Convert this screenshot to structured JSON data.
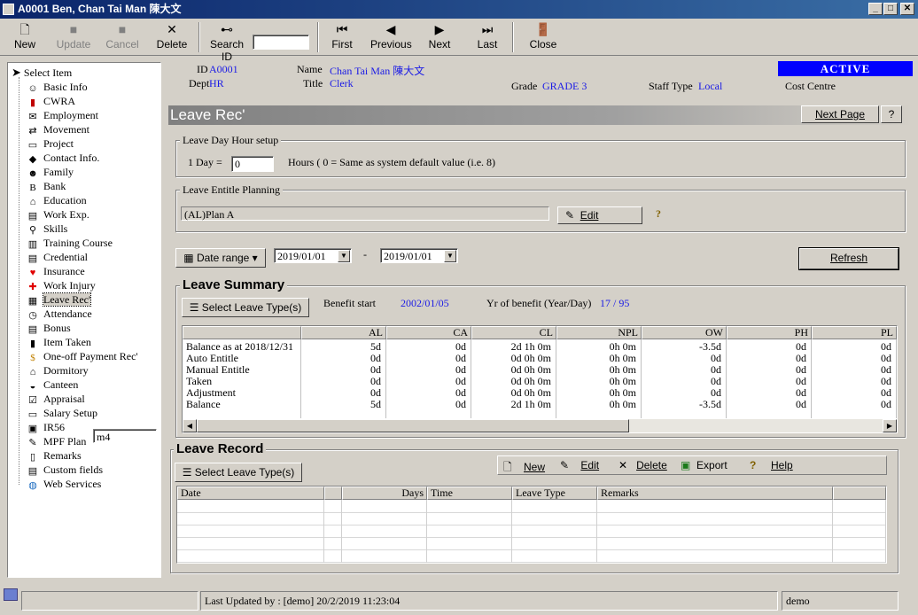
{
  "window": {
    "title": "A0001 Ben, Chan Tai Man 陳大文"
  },
  "toolbar": {
    "new": "New",
    "update": "Update",
    "cancel": "Cancel",
    "delete": "Delete",
    "search_id": "Search ID",
    "search_value": "",
    "first": "First",
    "previous": "Previous",
    "next": "Next",
    "last": "Last",
    "close": "Close"
  },
  "sidebar": {
    "select_item": "Select Item",
    "items": [
      "Basic Info",
      "CWRA",
      "Employment",
      "Movement",
      "Project",
      "Contact Info.",
      "Family",
      "Bank",
      "Education",
      "Work Exp.",
      "Skills",
      "Training Course",
      "Credential",
      "Insurance",
      "Work Injury",
      "Leave Rec'",
      "Attendance",
      "Bonus",
      "Item Taken",
      "One-off Payment Rec'",
      "Dormitory",
      "Canteen",
      "Appraisal",
      "Salary Setup",
      "IR56",
      "MPF Plan",
      "Remarks",
      "Custom fields",
      "Web Services"
    ],
    "mpf_input": "m4"
  },
  "employee": {
    "id_label": "ID",
    "id": "A0001",
    "name_label": "Name",
    "name": "Chan Tai Man  陳大文",
    "dept_label": "Dept",
    "dept": "HR",
    "title_label": "Title",
    "title": "Clerk",
    "grade_label": "Grade",
    "grade": "GRADE 3",
    "staff_type_label": "Staff Type",
    "staff_type": "Local",
    "cost_centre_label": "Cost Centre",
    "status": "ACTIVE"
  },
  "panel": {
    "title": "Leave Rec'",
    "next_page": "Next Page"
  },
  "leave_day_hour": {
    "group": "Leave Day Hour setup",
    "prefix": "1 Day =",
    "value": "0",
    "suffix": "Hours ( 0 = Same as system default value  (i.e. 8)"
  },
  "entitle_planning": {
    "group": "Leave Entitle Planning",
    "value": "(AL)Plan A",
    "edit": "Edit"
  },
  "date_range": {
    "button": "Date range",
    "from": "2019/01/01",
    "dash": "-",
    "to": "2019/01/01",
    "refresh": "Refresh"
  },
  "summary": {
    "title": "Leave Summary",
    "select_button": "Select Leave Type(s)",
    "benefit_start_label": "Benefit start",
    "benefit_start": "2002/01/05",
    "yr_benefit_label": "Yr of benefit (Year/Day)",
    "yr_benefit": "17 / 95",
    "columns": [
      "",
      "AL",
      "CA",
      "CL",
      "NPL",
      "OW",
      "PH",
      "PL"
    ],
    "rows": [
      [
        "Balance as at 2018/12/31",
        "5d",
        "0d",
        "2d  1h  0m",
        "0h  0m",
        "-3.5d",
        "0d",
        "0d"
      ],
      [
        "Auto Entitle",
        "0d",
        "0d",
        "0d  0h  0m",
        "0h  0m",
        "0d",
        "0d",
        "0d"
      ],
      [
        "Manual Entitle",
        "0d",
        "0d",
        "0d  0h  0m",
        "0h  0m",
        "0d",
        "0d",
        "0d"
      ],
      [
        "Taken",
        "0d",
        "0d",
        "0d  0h  0m",
        "0h  0m",
        "0d",
        "0d",
        "0d"
      ],
      [
        "Adjustment",
        "0d",
        "0d",
        "0d  0h  0m",
        "0h  0m",
        "0d",
        "0d",
        "0d"
      ],
      [
        "Balance",
        "5d",
        "0d",
        "2d  1h  0m",
        "0h  0m",
        "-3.5d",
        "0d",
        "0d"
      ]
    ]
  },
  "record": {
    "title": "Leave Record",
    "select_button": "Select Leave Type(s)",
    "new": "New",
    "edit": "Edit",
    "delete": "Delete",
    "export": "Export",
    "help": "Help",
    "columns": [
      "Date",
      "",
      "Days",
      "Time",
      "Leave Type",
      "Remarks"
    ]
  },
  "status": {
    "last_updated": "Last Updated by : [demo]  20/2/2019 11:23:04",
    "user": "demo"
  }
}
